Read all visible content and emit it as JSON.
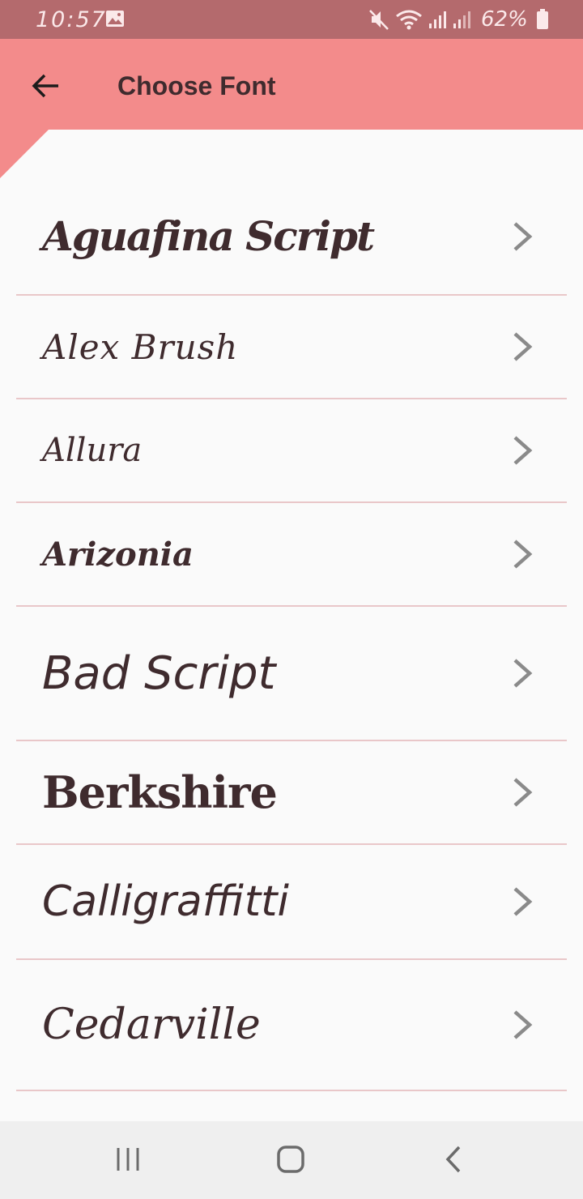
{
  "status_bar": {
    "time": "10:57",
    "battery": "62%",
    "icons": [
      "gallery-icon",
      "mute-icon",
      "wifi-icon",
      "signal-icon",
      "signal-icon",
      "battery-icon"
    ]
  },
  "app_bar": {
    "title": "Choose Font",
    "back_icon": "arrow-back-icon",
    "color": "#f38b8b"
  },
  "fonts": [
    {
      "label": "Aguafina Script"
    },
    {
      "label": "Alex Brush"
    },
    {
      "label": "Allura"
    },
    {
      "label": "Arizonia"
    },
    {
      "label": "Bad Script"
    },
    {
      "label": "Berkshire"
    },
    {
      "label": "Calligraffitti"
    },
    {
      "label": "Cedarville"
    },
    {
      "label": ""
    }
  ],
  "nav_bar": {
    "icons": [
      "recent-apps-icon",
      "home-icon",
      "back-icon"
    ]
  },
  "colors": {
    "status_bar": "#b46a6d",
    "divider": "#e9c7c9",
    "text": "#3f2b2e",
    "chevron": "#8a8a8a"
  }
}
